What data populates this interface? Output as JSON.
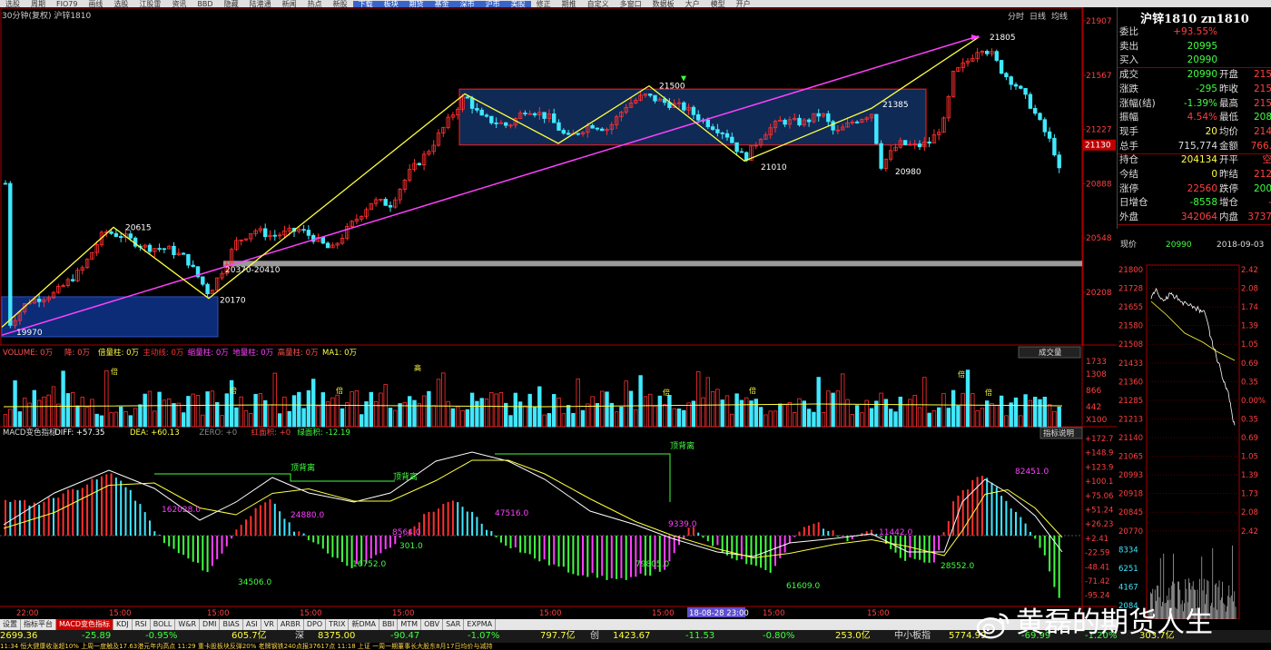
{
  "toolbar": {
    "items": [
      "选股",
      "周期",
      "FIO79",
      "画线",
      "选股",
      "江股雷",
      "资讯",
      "BBD",
      "隐藏",
      "陆港通",
      "新闻",
      "热点",
      "新股",
      "下载",
      "板块",
      "期货",
      "基金",
      "深市",
      "沪市",
      "美股",
      "修正",
      "期推",
      "自定义",
      "多窗口",
      "数据板",
      "大户",
      "模型",
      "开户"
    ]
  },
  "chart": {
    "title": "30分钟(复权) 沪锌1810",
    "tabs_right": [
      "分时",
      "日线",
      "均线"
    ],
    "price_axis": [
      "21907",
      "21567",
      "21227",
      "20888",
      "20548",
      "20208"
    ],
    "current_price": "21130",
    "annotations": {
      "top": "21805",
      "box_top_left": "21500",
      "box_right_upper": "21385",
      "box_low": "21010",
      "box_low2": "20980",
      "left_peak": "20615",
      "left_low": "20170",
      "bottom": "19970",
      "gray_line": "20370-20410"
    }
  },
  "volume": {
    "legend": [
      {
        "text": "VOLUME: 0万",
        "color": "#ff5050"
      },
      {
        "text": "降: 0万",
        "color": "#ff5050"
      },
      {
        "text": "倍量柱: 0万",
        "color": "#ffff40"
      },
      {
        "text": "主动线: 0万",
        "color": "#ff3030"
      },
      {
        "text": "缩量柱: 0万",
        "color": "#ff40ff"
      },
      {
        "text": "地量柱: 0万",
        "color": "#ff40ff"
      },
      {
        "text": "高量柱: 0万",
        "color": "#ff5050"
      },
      {
        "text": "MA1: 0万",
        "color": "#ffff40"
      }
    ],
    "dropdown": "成交量",
    "axis": [
      "1733",
      "1308",
      "866",
      "442",
      "X100"
    ],
    "bei": "倍",
    "gao": "高"
  },
  "macd": {
    "legend": [
      {
        "text": "MACD变色指标",
        "color": "#ddd"
      },
      {
        "text": "DIFF: +57.35",
        "color": "#fff"
      },
      {
        "text": "DEA: +60.13",
        "color": "#ffff40"
      },
      {
        "text": "ZERO: +0",
        "color": "#888"
      },
      {
        "text": "红面积: +0",
        "color": "#ff4040"
      },
      {
        "text": "绿面积: -12.19",
        "color": "#40ff40"
      }
    ],
    "side_label": "指标说明",
    "axis": [
      "+172.7",
      "+148.9",
      "+123.9",
      "+100.1",
      "+75.06",
      "+51.24",
      "+26.23",
      "+2.41",
      "-22.59",
      "-48.41",
      "-71.42",
      "-95.24"
    ],
    "divergence_labels": [
      "顶背离",
      "顶背离",
      "顶背离"
    ],
    "area_values": [
      {
        "text": "162028.0",
        "color": "#ff40ff"
      },
      {
        "text": "24880.0",
        "color": "#ff40ff"
      },
      {
        "text": "8564.0",
        "color": "#ff40ff"
      },
      {
        "text": "47516.0",
        "color": "#ff40ff"
      },
      {
        "text": "9339.0",
        "color": "#ff40ff"
      },
      {
        "text": "11442.0",
        "color": "#ff40ff"
      },
      {
        "text": "82451.0",
        "color": "#ff40ff"
      },
      {
        "text": "34506.0",
        "color": "#40ff40"
      },
      {
        "text": "16752.0",
        "color": "#40ff40"
      },
      {
        "text": "301.0",
        "color": "#40ff40"
      },
      {
        "text": "79805.0",
        "color": "#40ff40"
      },
      {
        "text": "61609.0",
        "color": "#40ff40"
      },
      {
        "text": "28552.0",
        "color": "#40ff40"
      }
    ]
  },
  "time_axis": [
    "22:00",
    "15:00",
    "15:00",
    "15:00",
    "15:00",
    "15:00",
    "15:00",
    "15:00",
    "15:00"
  ],
  "cursor_time": "18-08-28 23:00",
  "bottom_tabs": [
    "设置",
    "指标平台",
    "MACD变色指标",
    "KDJ",
    "RSI",
    "BOLL",
    "W&R",
    "DMI",
    "BIAS",
    "ASI",
    "VR",
    "ARBR",
    "DPO",
    "TRIX",
    "新DMA",
    "BBI",
    "MTM",
    "OBV",
    "SAR",
    "EXPMA"
  ],
  "quote": {
    "title": "沪锌1810 zn1810",
    "rows": [
      {
        "l1": "委比",
        "v1": "+93.55%",
        "c1": "#ff4040"
      },
      {
        "l1": "卖出",
        "v1": "20995",
        "c1": "#40ff40"
      },
      {
        "l1": "买入",
        "v1": "20990",
        "c1": "#40ff40"
      },
      {
        "l1": "成交",
        "v1": "20990",
        "c1": "#40ff40",
        "l2": "开盘",
        "v2": "215"
      },
      {
        "l1": "涨跌",
        "v1": "-295",
        "c1": "#40ff40",
        "l2": "昨收",
        "v2": "215"
      },
      {
        "l1": "涨幅(结)",
        "v1": "-1.39%",
        "c1": "#40ff40",
        "l2": "最高",
        "v2": "215"
      },
      {
        "l1": "振幅",
        "v1": "4.54%",
        "c1": "#ff4040",
        "l2": "最低",
        "v2": "208"
      },
      {
        "l1": "现手",
        "v1": "20",
        "c1": "#ffff40",
        "l2": "均价",
        "v2": "214"
      },
      {
        "l1": "总手",
        "v1": "715,774",
        "c1": "#ddd",
        "l2": "金额",
        "v2": "766."
      },
      {
        "l1": "持仓",
        "v1": "204134",
        "c1": "#ffff40",
        "l2": "开平",
        "v2": "空"
      },
      {
        "l1": "今结",
        "v1": "0",
        "c1": "#ffff40",
        "l2": "昨结",
        "v2": "212"
      },
      {
        "l1": "涨停",
        "v1": "22560",
        "c1": "#ff4040",
        "l2": "跌停",
        "v2": "200"
      },
      {
        "l1": "日增仓",
        "v1": "-8558",
        "c1": "#40ff40",
        "l2": "增仓",
        "v2": "-"
      },
      {
        "l1": "外盘",
        "v1": "342064",
        "c1": "#ff4040",
        "l2": "内盘",
        "v2": "3737"
      }
    ]
  },
  "minichart": {
    "label": "现价",
    "price": "20990",
    "date": "2018-09-03",
    "y_left": [
      "21800",
      "21728",
      "21655",
      "21580",
      "21508",
      "21433",
      "21360",
      "21285",
      "21213",
      "21140",
      "21065",
      "20993",
      "20918",
      "20845",
      "20770",
      "8334",
      "6251",
      "4167",
      "2084"
    ],
    "y_right": [
      "2.42",
      "2.08",
      "1.74",
      "1.39",
      "1.05",
      "0.69",
      "0.35",
      "0.00%",
      "0.35",
      "0.69",
      "1.05",
      "1.39",
      "1.73",
      "2.08",
      "2.42"
    ]
  },
  "statusbar": [
    {
      "t": "2699.36",
      "c": "#ffff40",
      "w": 90
    },
    {
      "t": "-25.89",
      "c": "#40ff40",
      "w": 70
    },
    {
      "t": "-0.95%",
      "c": "#40ff40",
      "w": 95
    },
    {
      "t": "605.7亿",
      "c": "#ffff40",
      "w": 70
    },
    {
      "t": "深",
      "c": "#ddd",
      "w": 25
    },
    {
      "t": "8375.00",
      "c": "#ffff40",
      "w": 80
    },
    {
      "t": "-90.47",
      "c": "#40ff40",
      "w": 85
    },
    {
      "t": "-1.07%",
      "c": "#40ff40",
      "w": 80
    },
    {
      "t": "797.7亿",
      "c": "#ffff40",
      "w": 55
    },
    {
      "t": "创",
      "c": "#ddd",
      "w": 25
    },
    {
      "t": "1423.67",
      "c": "#ffff40",
      "w": 80
    },
    {
      "t": "-11.53",
      "c": "#40ff40",
      "w": 85
    },
    {
      "t": "-0.80%",
      "c": "#40ff40",
      "w": 80
    },
    {
      "t": "253.0亿",
      "c": "#ffff40",
      "w": 65
    },
    {
      "t": "中小板指",
      "c": "#ddd",
      "w": 60
    },
    {
      "t": "5774.99",
      "c": "#ffff40",
      "w": 80
    },
    {
      "t": "-69.99",
      "c": "#40ff40",
      "w": 70
    },
    {
      "t": "-1.20%",
      "c": "#40ff40",
      "w": 60
    },
    {
      "t": "303.7亿",
      "c": "#ffff40",
      "w": 45
    }
  ],
  "ticker": "11:34 恒大健康收涨超10% 上周一度触及17.63港元年内高点   11:29 重卡股板块反弹20%  老牌钢铁240点报37617点   11:18 上证  一周一期董事长大股东8月17日均价与减持",
  "watermark": "黄磊的期货人生"
}
